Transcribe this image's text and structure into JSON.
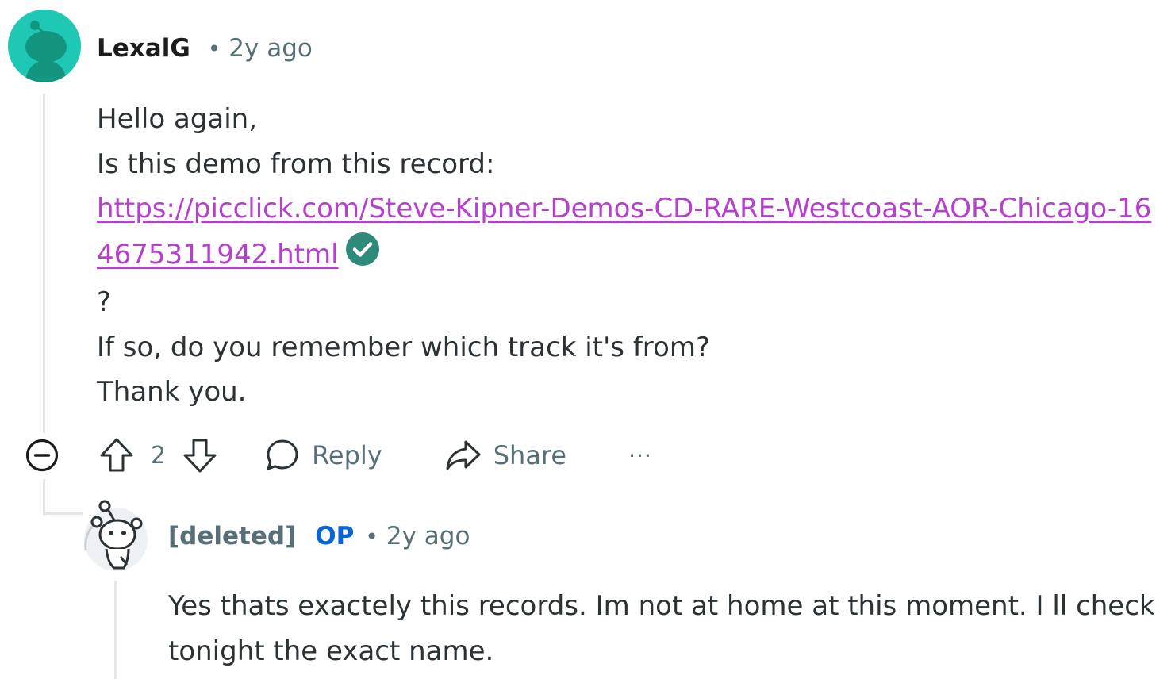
{
  "comment": {
    "author": "LexalG",
    "separator": "•",
    "time": "2y ago",
    "lines": [
      "Hello again,",
      "Is this demo from this record:"
    ],
    "link_text": "https://picclick.com/Steve-Kipner-Demos-CD-RARE-Westcoast-AOR-Chicago-164675311942.html",
    "after_link_lines": [
      "?",
      "If so, do you remember which track it's from?",
      "Thank you."
    ],
    "link_color": "#b73fd0",
    "avatar_color": "#1ec8b4",
    "verified_icon_color": "#2e8b7a"
  },
  "actions": {
    "vote_count": "2",
    "reply_label": "Reply",
    "share_label": "Share",
    "more_label": "···"
  },
  "reply": {
    "author": "[deleted]",
    "op_badge": "OP",
    "op_color": "#0a64d8",
    "separator": "•",
    "time": "2y ago",
    "text": "Yes thats exactely this records. Im not at home at this moment. I ll check tonight the exact name."
  }
}
